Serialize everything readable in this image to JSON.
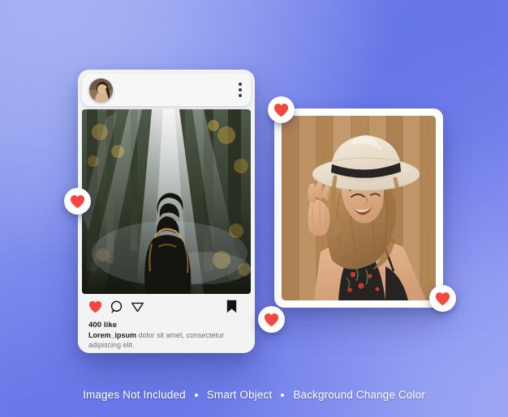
{
  "background": {
    "gradient_from": "#a8b4f4",
    "gradient_to": "#5665e5"
  },
  "post_card": {
    "header": {
      "avatar_name": "user-avatar",
      "menu_label": "More options"
    },
    "photo_alt": "Person in beanie looking at sunbeams in a forest",
    "actions": {
      "like_label": "Like",
      "comment_label": "Comment",
      "share_label": "Share",
      "save_label": "Save"
    },
    "likes_text": "400 like",
    "caption_username": "Lorem_ipsum",
    "caption_text": " dolor sit amet, consectetur adipiscing elit."
  },
  "frame_card": {
    "photo_alt": "Smiling woman wearing a white hat against a wooden fence"
  },
  "heart_badges": [
    {
      "name": "heart-badge-left",
      "color": "#f5463f"
    },
    {
      "name": "heart-badge-top-right",
      "color": "#f5463f"
    },
    {
      "name": "heart-badge-bottom-mid",
      "color": "#f5463f"
    },
    {
      "name": "heart-badge-bottom-right",
      "color": "#f5463f"
    }
  ],
  "footer_note": {
    "item1": "Images Not Included",
    "item2": "Smart Object",
    "item3": "Background Change Color"
  },
  "colors": {
    "heart_red": "#f5463f",
    "icon_dark": "#131316",
    "card_bg": "#f3f3f3"
  }
}
